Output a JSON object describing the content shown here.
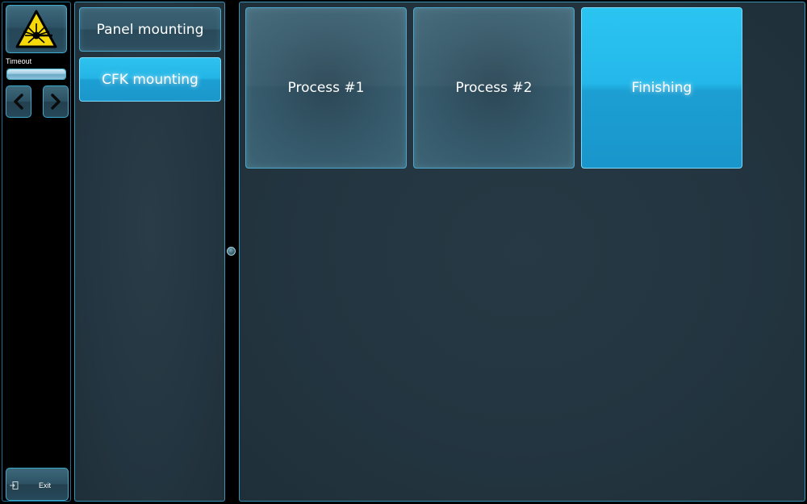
{
  "sidebar": {
    "warning_icon": "laser-warning-icon",
    "timeout_label": "Timeout",
    "timeout_progress": 1.0,
    "prev_icon": "chevron-left-icon",
    "next_icon": "chevron-right-icon",
    "exit_label": "Exit",
    "exit_icon": "exit-icon"
  },
  "categories": [
    {
      "label": "Panel mounting",
      "active": false
    },
    {
      "label": "CFK mounting",
      "active": true
    }
  ],
  "tiles": [
    {
      "label": "Process #1",
      "active": false
    },
    {
      "label": "Process #2",
      "active": false
    },
    {
      "label": "Finishing",
      "active": true
    }
  ],
  "colors": {
    "accent": "#24b5e6",
    "panel_bg": "#233540",
    "border": "#3a93b5",
    "warning_yellow": "#f5d90a"
  }
}
